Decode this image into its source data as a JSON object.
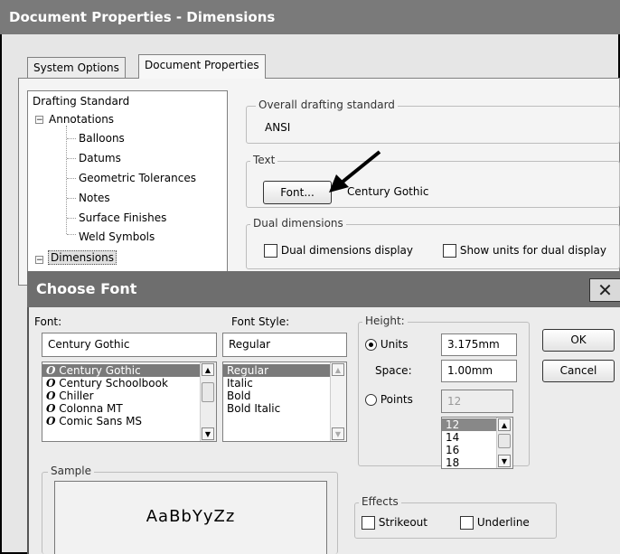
{
  "window": {
    "title": "Document Properties - Dimensions"
  },
  "tabs": [
    {
      "label": "System Options"
    },
    {
      "label": "Document Properties"
    }
  ],
  "tree": {
    "drafting_standard": "Drafting Standard",
    "annotations": "Annotations",
    "annotation_children": [
      "Balloons",
      "Datums",
      "Geometric Tolerances",
      "Notes",
      "Surface Finishes",
      "Weld Symbols"
    ],
    "dimensions": "Dimensions",
    "expander_symbol": "−"
  },
  "overall_standard": {
    "legend": "Overall drafting standard",
    "value": "ANSI"
  },
  "text_group": {
    "legend": "Text",
    "font_button": "Font...",
    "font_name": "Century Gothic"
  },
  "dual_dimensions": {
    "legend": "Dual dimensions",
    "display_label": "Dual dimensions display",
    "show_units_label": "Show units for dual display"
  },
  "choose_font": {
    "title": "Choose Font",
    "close_symbol": "✕",
    "font_label": "Font:",
    "font_value": "Century Gothic",
    "fonts": [
      "Century Gothic",
      "Century Schoolbook",
      "Chiller",
      "Colonna MT",
      "Comic Sans MS"
    ],
    "font_glyph": "O",
    "style_label": "Font Style:",
    "style_value": "Regular",
    "styles": [
      "Regular",
      "Italic",
      "Bold",
      "Bold Italic"
    ],
    "height": {
      "legend": "Height:",
      "units_label": "Units",
      "units_value": "3.175mm",
      "space_label": "Space:",
      "space_value": "1.00mm",
      "points_label": "Points",
      "points_value": "12",
      "points_list": [
        "12",
        "14",
        "16",
        "18"
      ]
    },
    "ok": "OK",
    "cancel": "Cancel",
    "sample": {
      "legend": "Sample",
      "text": "AaBbYyZz"
    },
    "effects": {
      "legend": "Effects",
      "strikeout": "Strikeout",
      "underline": "Underline"
    }
  },
  "scroll_symbols": {
    "up": "▲",
    "down": "▼"
  }
}
